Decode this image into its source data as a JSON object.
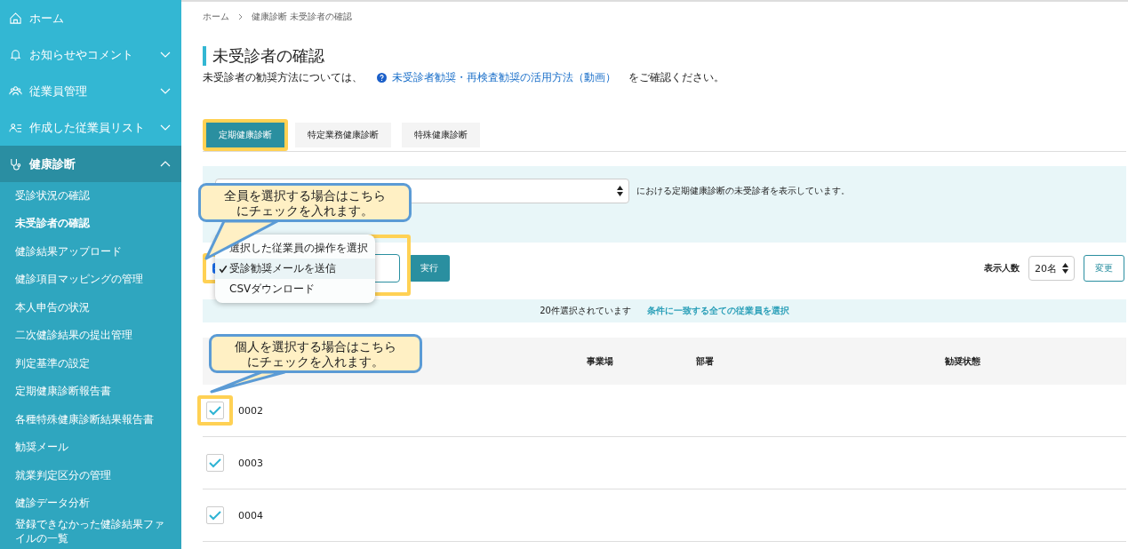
{
  "sidebar": {
    "items": [
      {
        "label": "ホーム",
        "expandable": false,
        "expanded": false
      },
      {
        "label": "お知らせやコメント",
        "expandable": true,
        "expanded": false
      },
      {
        "label": "従業員管理",
        "expandable": true,
        "expanded": false
      },
      {
        "label": "作成した従業員リスト",
        "expandable": true,
        "expanded": false
      },
      {
        "label": "健康診断",
        "expandable": true,
        "expanded": true,
        "children": [
          {
            "label": "受診状況の確認",
            "selected": false
          },
          {
            "label": "未受診者の確認",
            "selected": true
          },
          {
            "label": "健診結果アップロード",
            "selected": false
          },
          {
            "label": "健診項目マッピングの管理",
            "selected": false
          },
          {
            "label": "本人申告の状況",
            "selected": false
          },
          {
            "label": "二次健診結果の提出管理",
            "selected": false
          },
          {
            "label": "判定基準の設定",
            "selected": false
          },
          {
            "label": "定期健康診断報告書",
            "selected": false
          },
          {
            "label": "各種特殊健康診断結果報告書",
            "selected": false
          },
          {
            "label": "勧奨メール",
            "selected": false
          },
          {
            "label": "就業判定区分の管理",
            "selected": false
          },
          {
            "label": "健診データ分析",
            "selected": false
          },
          {
            "label": "登録できなかった健診結果ファイルの一覧",
            "selected": false
          }
        ]
      }
    ]
  },
  "breadcrumb": [
    "ホーム",
    "健康診断 未受診者の確認"
  ],
  "title": "未受診者の確認",
  "intro": {
    "before": "未受診者の勧奨方法については、",
    "link": "未受診者勧奨・再検査勧奨の活用方法（動画）",
    "after": "をご確認ください。"
  },
  "tabs": [
    {
      "label": "定期健康診断",
      "selected": true,
      "highlighted": true
    },
    {
      "label": "特定業務健康診断",
      "selected": false,
      "highlighted": false
    },
    {
      "label": "特殊健康診断",
      "selected": false,
      "highlighted": false
    }
  ],
  "filter": {
    "suffix": "における定期健康診断の未受診者を表示しています。"
  },
  "bulk": {
    "select_all": {
      "checked": true,
      "highlighted": true
    },
    "action_menu": {
      "items": [
        {
          "label": "選択した従業員の操作を選択",
          "selected": false
        },
        {
          "label": "受診勧奨メールを送信",
          "selected": true
        },
        {
          "label": "CSVダウンロード",
          "selected": false
        }
      ]
    },
    "run_button": "実行",
    "per_page_label": "表示人数",
    "per_page_value": "20名",
    "change_button": "変更"
  },
  "selection_bar": {
    "count": "20件選択されています",
    "link": "条件に一致する全ての従業員を選択"
  },
  "table": {
    "columns": [
      "事業場",
      "部署",
      "勧奨状態"
    ],
    "rows": [
      {
        "id": "0002",
        "checked": true,
        "highlighted": true
      },
      {
        "id": "0003",
        "checked": true,
        "highlighted": false
      },
      {
        "id": "0004",
        "checked": true,
        "highlighted": false
      }
    ]
  },
  "callouts": [
    "全員を選択する場合はこちらにチェックを入れます。",
    "個人を選択する場合はこちらにチェックを入れます。"
  ]
}
